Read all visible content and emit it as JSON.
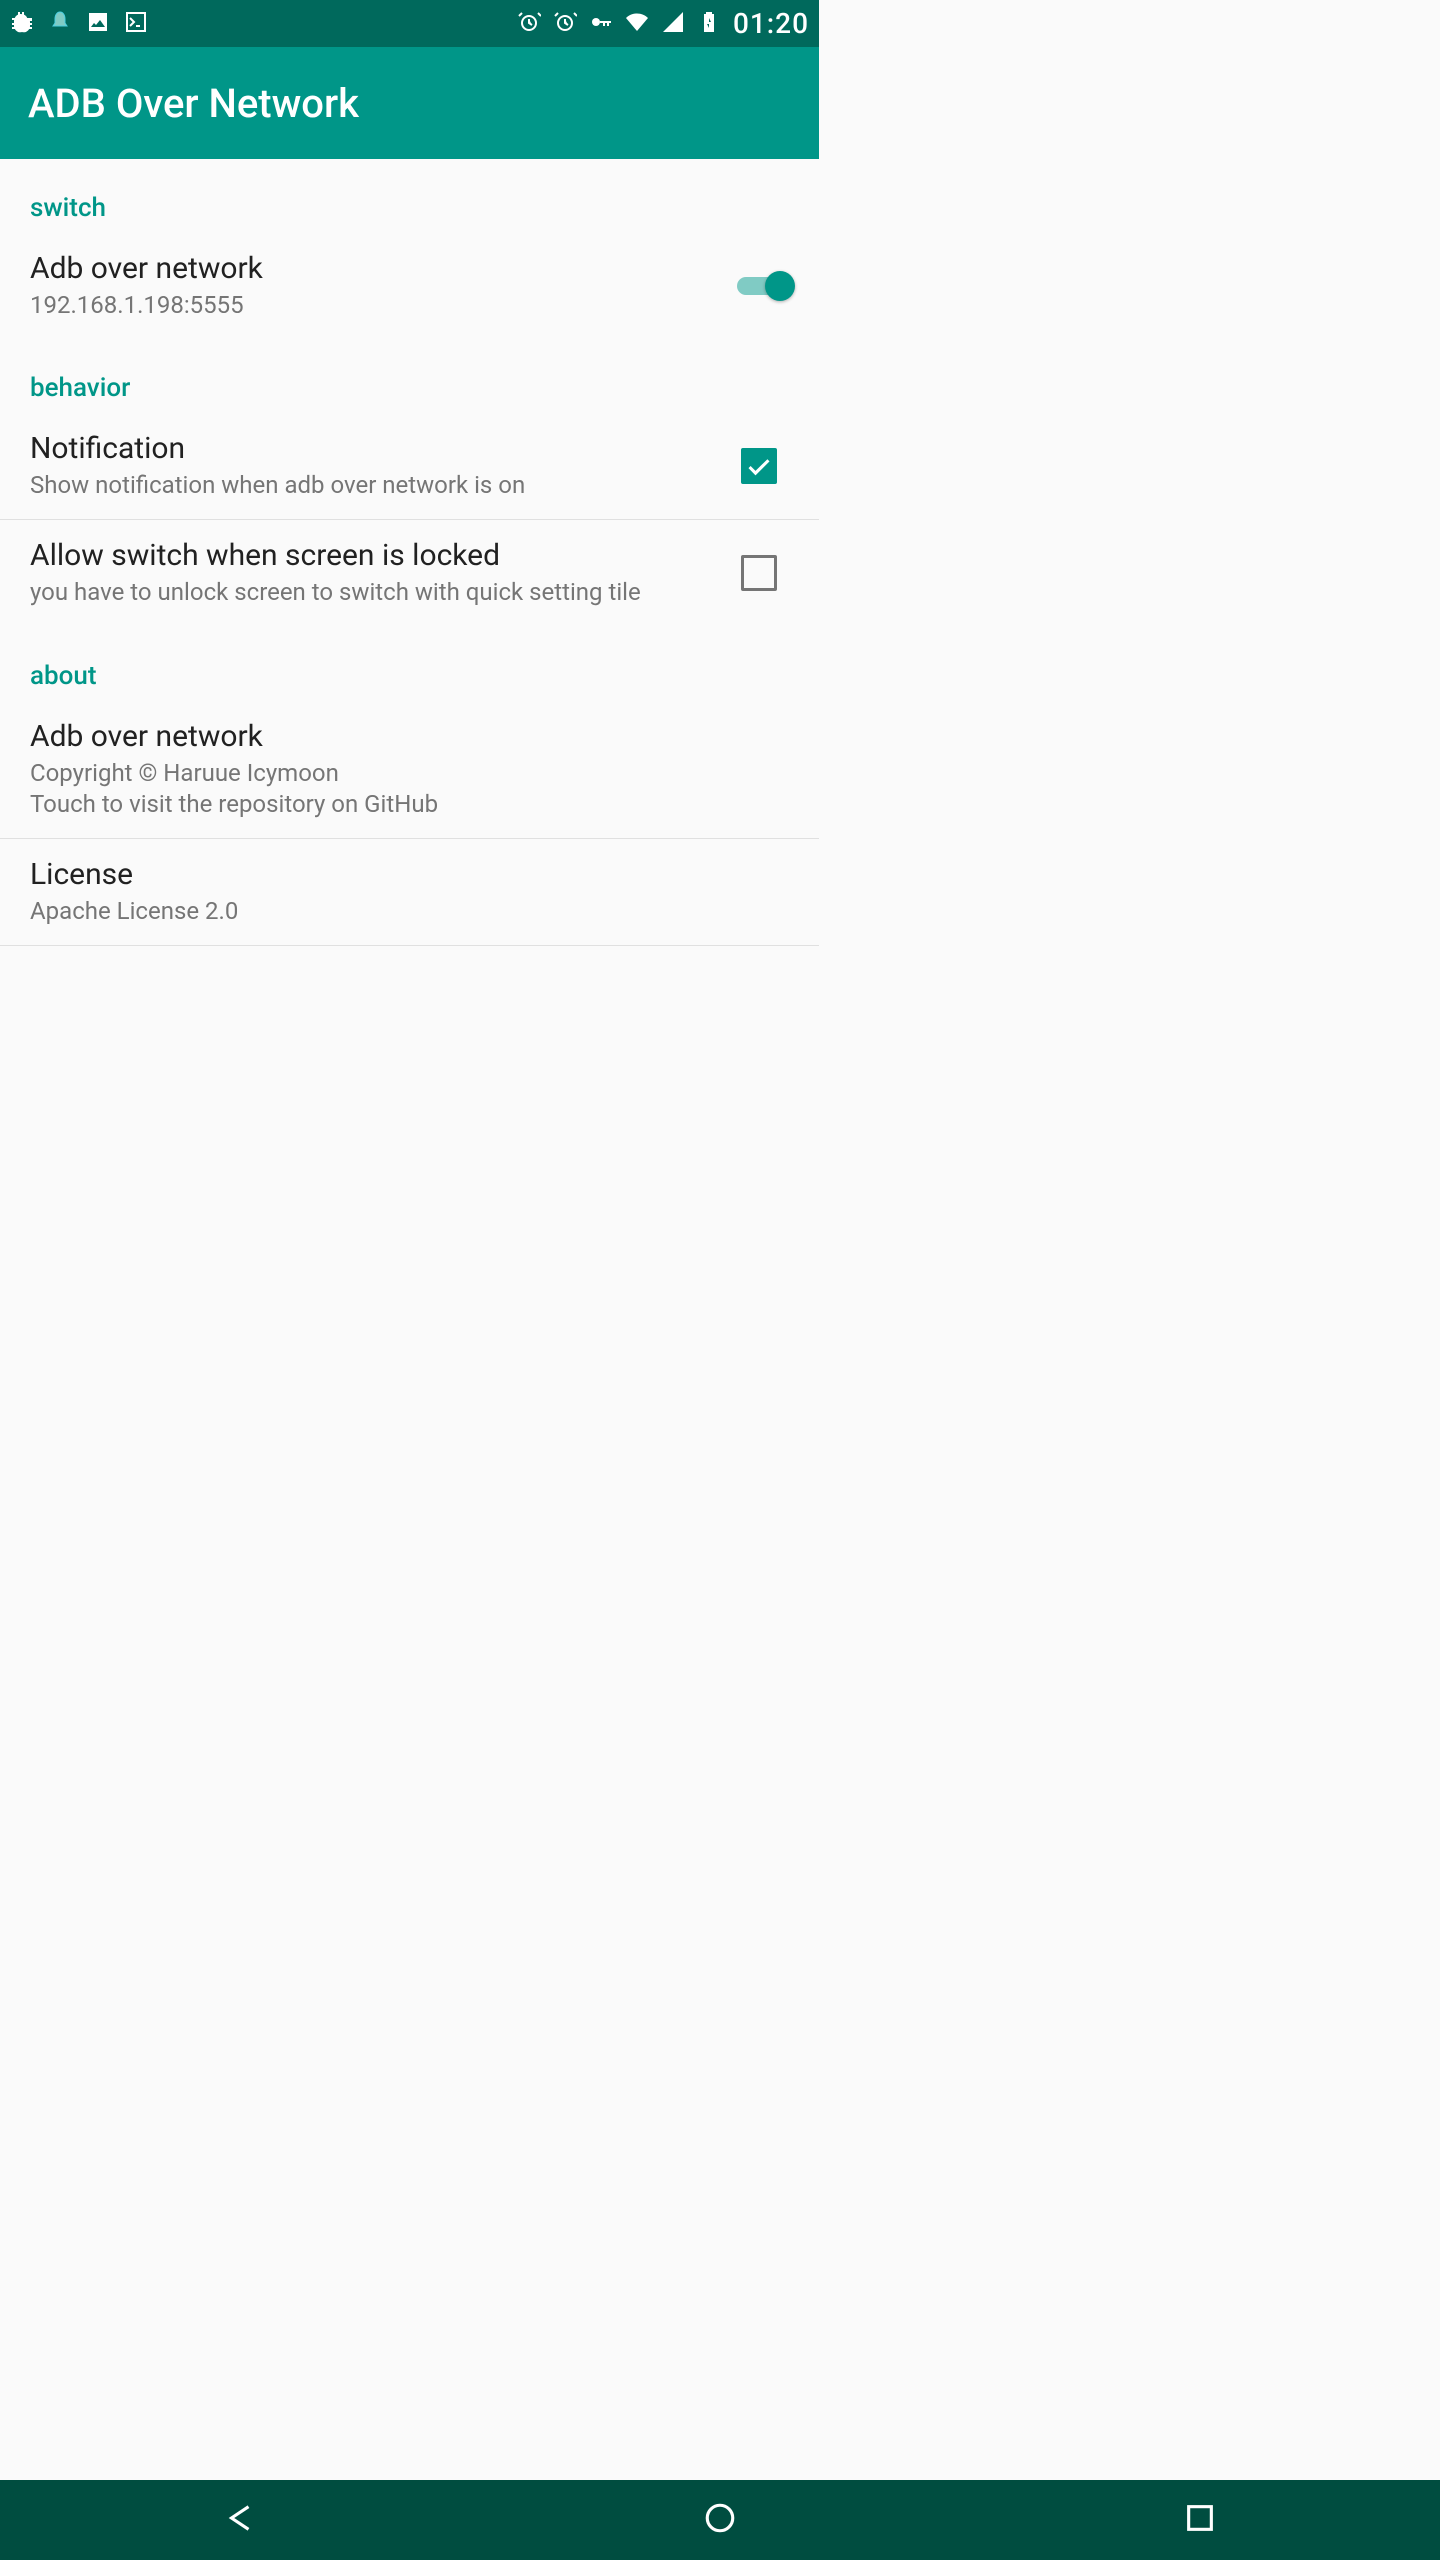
{
  "statusbar": {
    "clock": "01:20"
  },
  "appbar": {
    "title": "ADB Over Network"
  },
  "sections": {
    "switch": {
      "header": "switch",
      "item": {
        "title": "Adb over network",
        "summary": "192.168.1.198:5555",
        "on": true
      }
    },
    "behavior": {
      "header": "behavior",
      "notification": {
        "title": "Notification",
        "summary": "Show notification when adb over network is on",
        "checked": true
      },
      "allow_lock": {
        "title": "Allow switch when screen is locked",
        "summary": "you have to unlock screen to switch with quick setting tile",
        "checked": false
      }
    },
    "about": {
      "header": "about",
      "app": {
        "title": "Adb over network",
        "summary": "Copyright © Haruue Icymoon\nTouch to visit the repository on GitHub"
      },
      "license": {
        "title": "License",
        "summary": "Apache License 2.0"
      }
    }
  }
}
